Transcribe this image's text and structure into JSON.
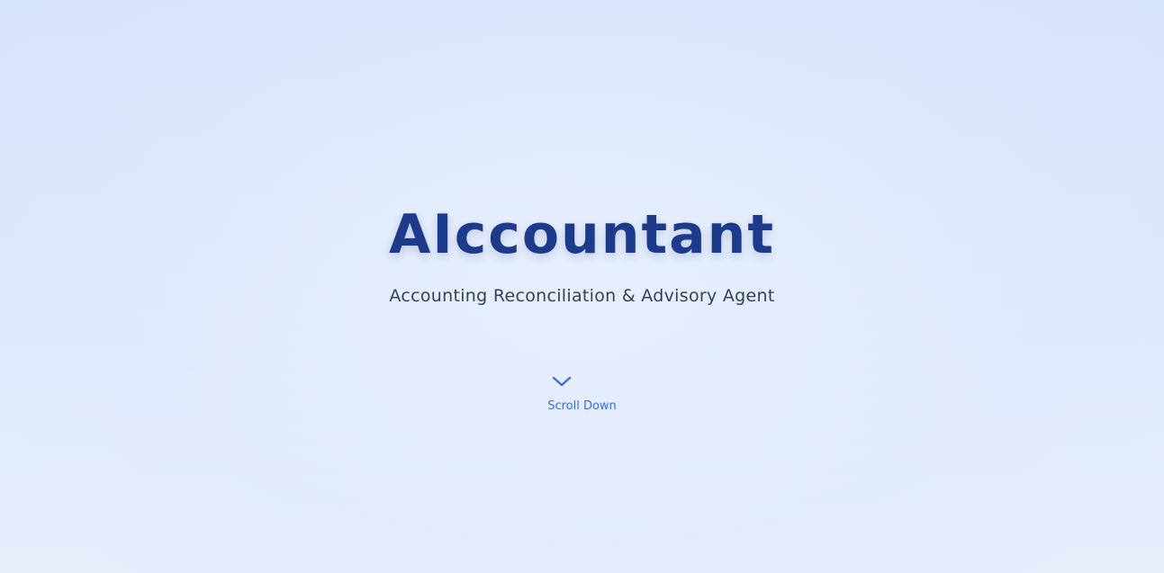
{
  "hero": {
    "title": "AIccountant",
    "subtitle": "Accounting Reconciliation & Advisory Agent"
  },
  "scroll": {
    "label": "Scroll Down",
    "icon": "chevron-down-icon"
  },
  "colors": {
    "title": "#1e3a8a",
    "subtitle": "#374151",
    "accent": "#3b6fe0",
    "background_top": "#d4e2fc",
    "background_bottom": "#e9eefb"
  }
}
